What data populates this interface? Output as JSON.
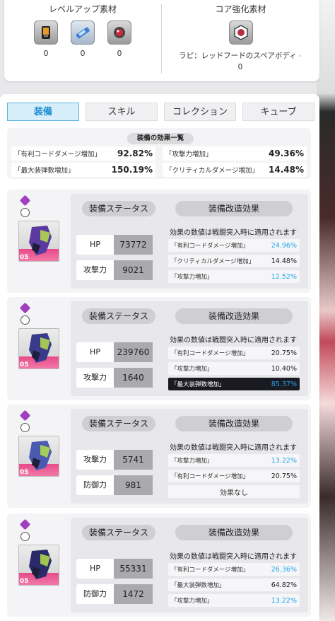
{
  "materials": {
    "levelup": {
      "title": "レベルアップ素材",
      "items": [
        {
          "icon": "chip-icon",
          "count": "0"
        },
        {
          "icon": "battery-icon",
          "count": "0"
        },
        {
          "icon": "core-orb-icon",
          "count": "0"
        }
      ]
    },
    "core": {
      "title": "コア強化素材",
      "icon": "spare-body-icon",
      "desc": "ラピ：レッドフードのスペアボディ",
      "dot": "-",
      "count": "0"
    }
  },
  "tabs": [
    "装備",
    "スキル",
    "コレクション",
    "キューブ"
  ],
  "active_tab": 0,
  "effects": {
    "title": "装備の効果一覧",
    "items": [
      {
        "label": "「有利コードダメージ増加」",
        "value": "92.82%"
      },
      {
        "label": "「攻撃力増加」",
        "value": "49.36%"
      },
      {
        "label": "「最大装弾数増加」",
        "value": "150.19%"
      },
      {
        "label": "「クリティカルダメージ増加」",
        "value": "14.48%"
      }
    ]
  },
  "equip_common": {
    "status_label": "装備ステータス",
    "mod_label": "装備改造効果",
    "note": "効果の数値は戦闘突入時に適用されます",
    "level": "05"
  },
  "equips": [
    {
      "stats": [
        {
          "label": "HP",
          "value": "73772"
        },
        {
          "label": "攻撃力",
          "value": "9021"
        }
      ],
      "mods": [
        {
          "label": "「有利コードダメージ増加」",
          "value": "24.96%",
          "blue": true
        },
        {
          "label": "「クリティカルダメージ増加」",
          "value": "14.48%",
          "blue": false
        },
        {
          "label": "「攻撃力増加」",
          "value": "12.52%",
          "blue": true
        }
      ]
    },
    {
      "stats": [
        {
          "label": "HP",
          "value": "239760"
        },
        {
          "label": "攻撃力",
          "value": "1640"
        }
      ],
      "mods": [
        {
          "label": "「有利コードダメージ増加」",
          "value": "20.75%",
          "blue": false
        },
        {
          "label": "「攻撃力増加」",
          "value": "10.40%",
          "blue": false
        },
        {
          "label": "「最大装弾数増加」",
          "value": "85.37%",
          "blue": true,
          "dark": true
        }
      ]
    },
    {
      "stats": [
        {
          "label": "攻撃力",
          "value": "5741"
        },
        {
          "label": "防御力",
          "value": "981"
        }
      ],
      "mods": [
        {
          "label": "「攻撃力増加」",
          "value": "13.22%",
          "blue": true
        },
        {
          "label": "「有利コードダメージ増加」",
          "value": "20.75%",
          "blue": false
        },
        {
          "label": "効果なし",
          "value": "",
          "none": true
        }
      ]
    },
    {
      "stats": [
        {
          "label": "HP",
          "value": "55331"
        },
        {
          "label": "防御力",
          "value": "1472"
        }
      ],
      "mods": [
        {
          "label": "「有利コードダメージ増加」",
          "value": "26.36%",
          "blue": true
        },
        {
          "label": "「最大装弾数増加」",
          "value": "64.82%",
          "blue": false
        },
        {
          "label": "「攻撃力増加」",
          "value": "13.22%",
          "blue": true
        }
      ]
    }
  ],
  "colors": {
    "accent": "#1a8ad0",
    "mod_blue": "#22a6e8",
    "rarity_pink": "#e84a8a"
  }
}
